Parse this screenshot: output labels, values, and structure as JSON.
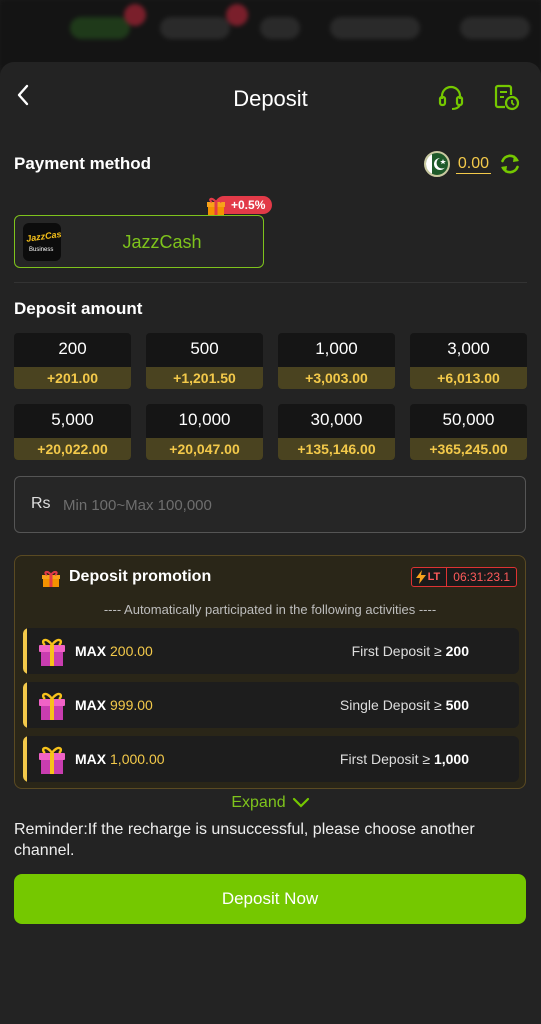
{
  "header": {
    "title": "Deposit",
    "back_icon": "chevron-left-icon",
    "support_icon": "headset-icon",
    "history_icon": "history-icon"
  },
  "payment": {
    "section_title": "Payment method",
    "balance": "0.00",
    "method": {
      "label": "JazzCash",
      "logo_text": "JazzCash",
      "logo_sub": "Business",
      "bonus": "+0.5%"
    }
  },
  "deposit": {
    "section_title": "Deposit amount",
    "amounts": [
      {
        "value": "200",
        "bonus": "+201.00"
      },
      {
        "value": "500",
        "bonus": "+1,201.50"
      },
      {
        "value": "1,000",
        "bonus": "+3,003.00"
      },
      {
        "value": "3,000",
        "bonus": "+6,013.00"
      },
      {
        "value": "5,000",
        "bonus": "+20,022.00"
      },
      {
        "value": "10,000",
        "bonus": "+20,047.00"
      },
      {
        "value": "30,000",
        "bonus": "+135,146.00"
      },
      {
        "value": "50,000",
        "bonus": "+365,245.00"
      }
    ],
    "currency": "Rs",
    "input_value": "",
    "input_placeholder": "Min 100~Max 100,000"
  },
  "promotion": {
    "title": "Deposit promotion",
    "lt_label": "LT",
    "timer": "06:31:23.1",
    "subtitle": "---- Automatically participated in the following activities ----",
    "activities": [
      {
        "max_label": "MAX",
        "max_value": "200.00",
        "condition": "First Deposit ≥",
        "threshold": "200"
      },
      {
        "max_label": "MAX",
        "max_value": "999.00",
        "condition": "Single Deposit ≥",
        "threshold": "500"
      },
      {
        "max_label": "MAX",
        "max_value": "1,000.00",
        "condition": "First Deposit ≥",
        "threshold": "1,000"
      }
    ],
    "expand_label": "Expand"
  },
  "reminder": "Reminder:If the recharge is unsuccessful, please choose another channel.",
  "submit_label": "Deposit Now",
  "colors": {
    "accent_green": "#75c800",
    "gold": "#f3c94a",
    "bonus_red": "#e23a48",
    "background": "#232323"
  }
}
